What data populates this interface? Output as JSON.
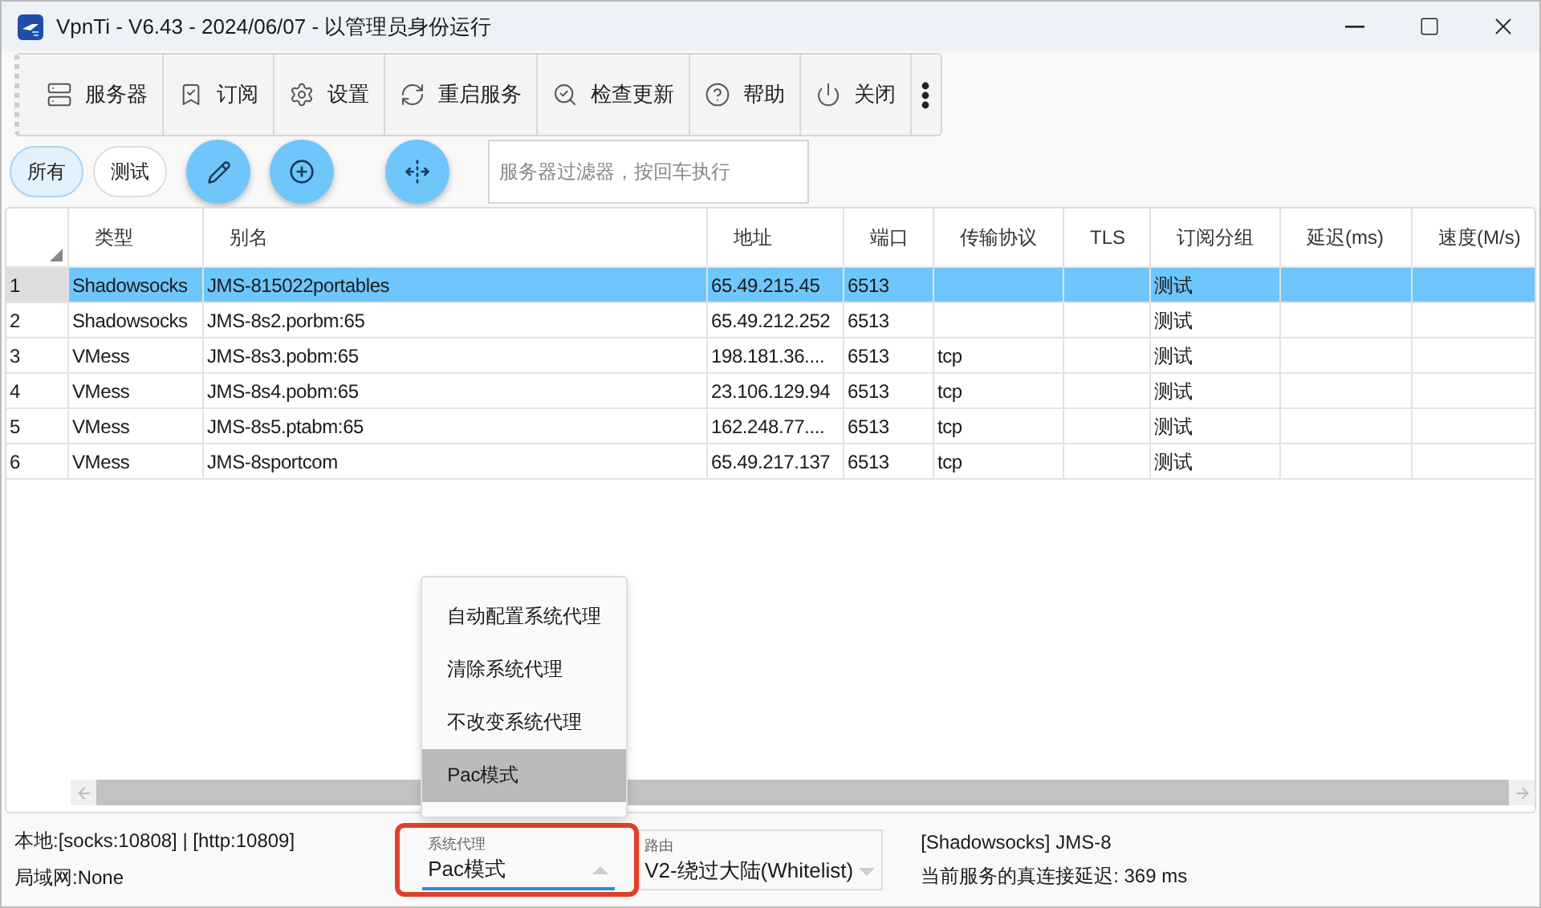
{
  "window": {
    "title": "VpnTi - V6.43 - 2024/06/07 - 以管理员身份运行"
  },
  "toolbar": [
    {
      "label": "服务器"
    },
    {
      "label": "订阅"
    },
    {
      "label": "设置"
    },
    {
      "label": "重启服务"
    },
    {
      "label": "检查更新"
    },
    {
      "label": "帮助"
    },
    {
      "label": "关闭"
    }
  ],
  "filter_tabs": [
    {
      "label": "所有",
      "selected": true
    },
    {
      "label": "测试",
      "selected": false
    }
  ],
  "filter": {
    "placeholder": "服务器过滤器，按回车执行"
  },
  "table": {
    "columns": [
      "类型",
      "别名",
      "地址",
      "端口",
      "传输协议",
      "TLS",
      "订阅分组",
      "延迟(ms)",
      "速度(M/s)"
    ],
    "rows": [
      {
        "number": "1",
        "selected": true,
        "cells": [
          "Shadowsocks",
          "JMS-815022portables",
          "65.49.215.45",
          "6513",
          null,
          null,
          "测试",
          null,
          null
        ]
      },
      {
        "number": "2",
        "selected": false,
        "cells": [
          "Shadowsocks",
          "JMS-8s2.porbm:65",
          "65.49.212.252",
          "6513",
          null,
          null,
          "测试",
          null,
          null
        ]
      },
      {
        "number": "3",
        "selected": false,
        "cells": [
          "VMess",
          "JMS-8s3.pobm:65",
          "198.181.36....",
          "6513",
          "tcp",
          null,
          "测试",
          null,
          null
        ]
      },
      {
        "number": "4",
        "selected": false,
        "cells": [
          "VMess",
          "JMS-8s4.pobm:65",
          "23.106.129.94",
          "6513",
          "tcp",
          null,
          "测试",
          null,
          null
        ]
      },
      {
        "number": "5",
        "selected": false,
        "cells": [
          "VMess",
          "JMS-8s5.ptabm:65",
          "162.248.77....",
          "6513",
          "tcp",
          null,
          "测试",
          null,
          null
        ]
      },
      {
        "number": "6",
        "selected": false,
        "cells": [
          "VMess",
          "JMS-8sportcom",
          "65.49.217.137",
          "6513",
          "tcp",
          null,
          "测试",
          null,
          null
        ]
      }
    ]
  },
  "status": {
    "local": "本地:[socks:10808] | [http:10809]",
    "lan": "局域网:None",
    "proxy_combo": {
      "label": "系统代理",
      "value": "Pac模式",
      "expanded": true
    },
    "proxy_menu": [
      {
        "label": "自动配置系统代理",
        "selected": false
      },
      {
        "label": "清除系统代理",
        "selected": false
      },
      {
        "label": "不改变系统代理",
        "selected": false
      },
      {
        "label": "Pac模式",
        "selected": true
      }
    ],
    "routing_combo": {
      "label": "路由",
      "value": "V2-绕过大陆(Whitelist)"
    },
    "server_info": "[Shadowsocks] JMS-8",
    "latency": "当前服务的真连接延迟: 369 ms"
  }
}
